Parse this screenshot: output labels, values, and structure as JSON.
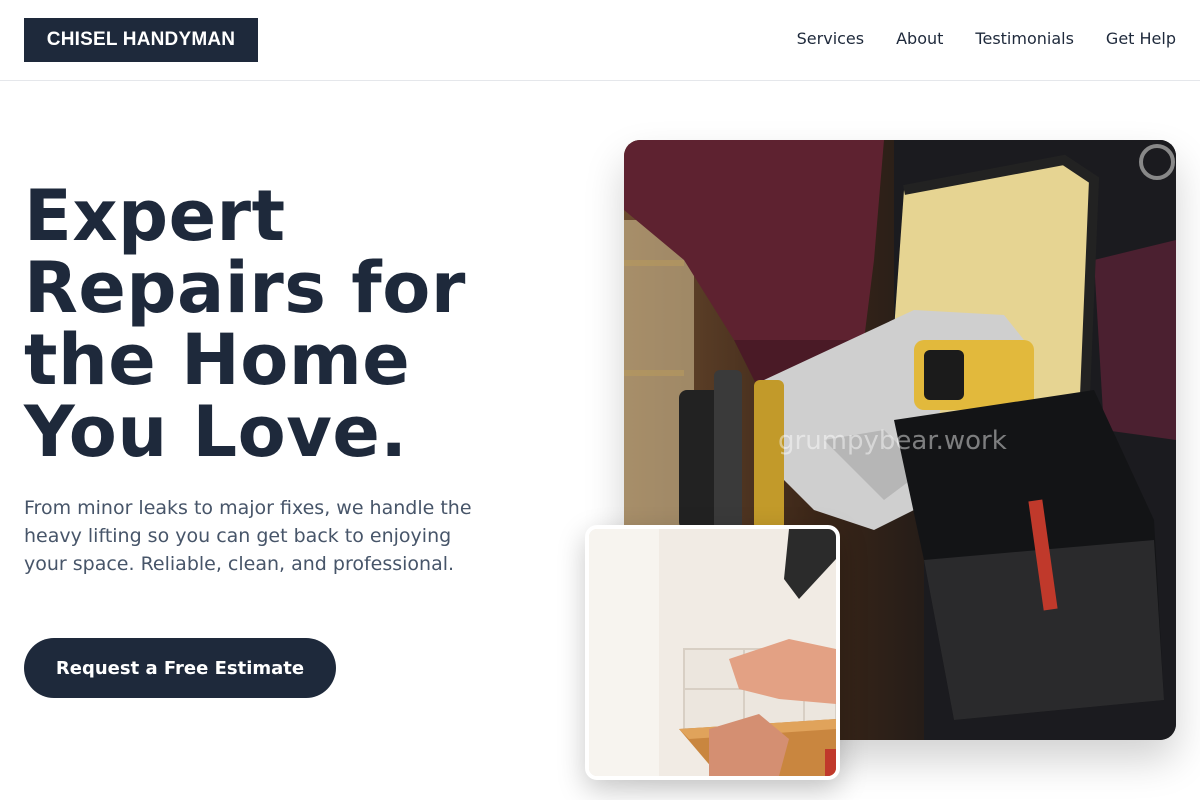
{
  "brand": {
    "logo_text": "CHISEL HANDYMAN"
  },
  "nav": {
    "items": [
      "Services",
      "About",
      "Testimonials",
      "Get Help"
    ]
  },
  "hero": {
    "title": "Expert Repairs for the Home You Love.",
    "title_lines": [
      "Expert",
      "Repairs for",
      "the Home",
      "You Love."
    ],
    "subtitle": "From minor leaks to major fixes, we handle the heavy lifting so you can get back to enjoying your space. Reliable, clean, and professional.",
    "cta_label": "Request a Free Estimate"
  },
  "images": {
    "main": {
      "watermark": "grumpybear.work",
      "subject": "handyman-tool-belt-photo"
    },
    "inset": {
      "subject": "tile-installation-photo"
    }
  },
  "colors": {
    "primary": "#1e293b",
    "text_muted": "#475569",
    "background": "#ffffff"
  }
}
